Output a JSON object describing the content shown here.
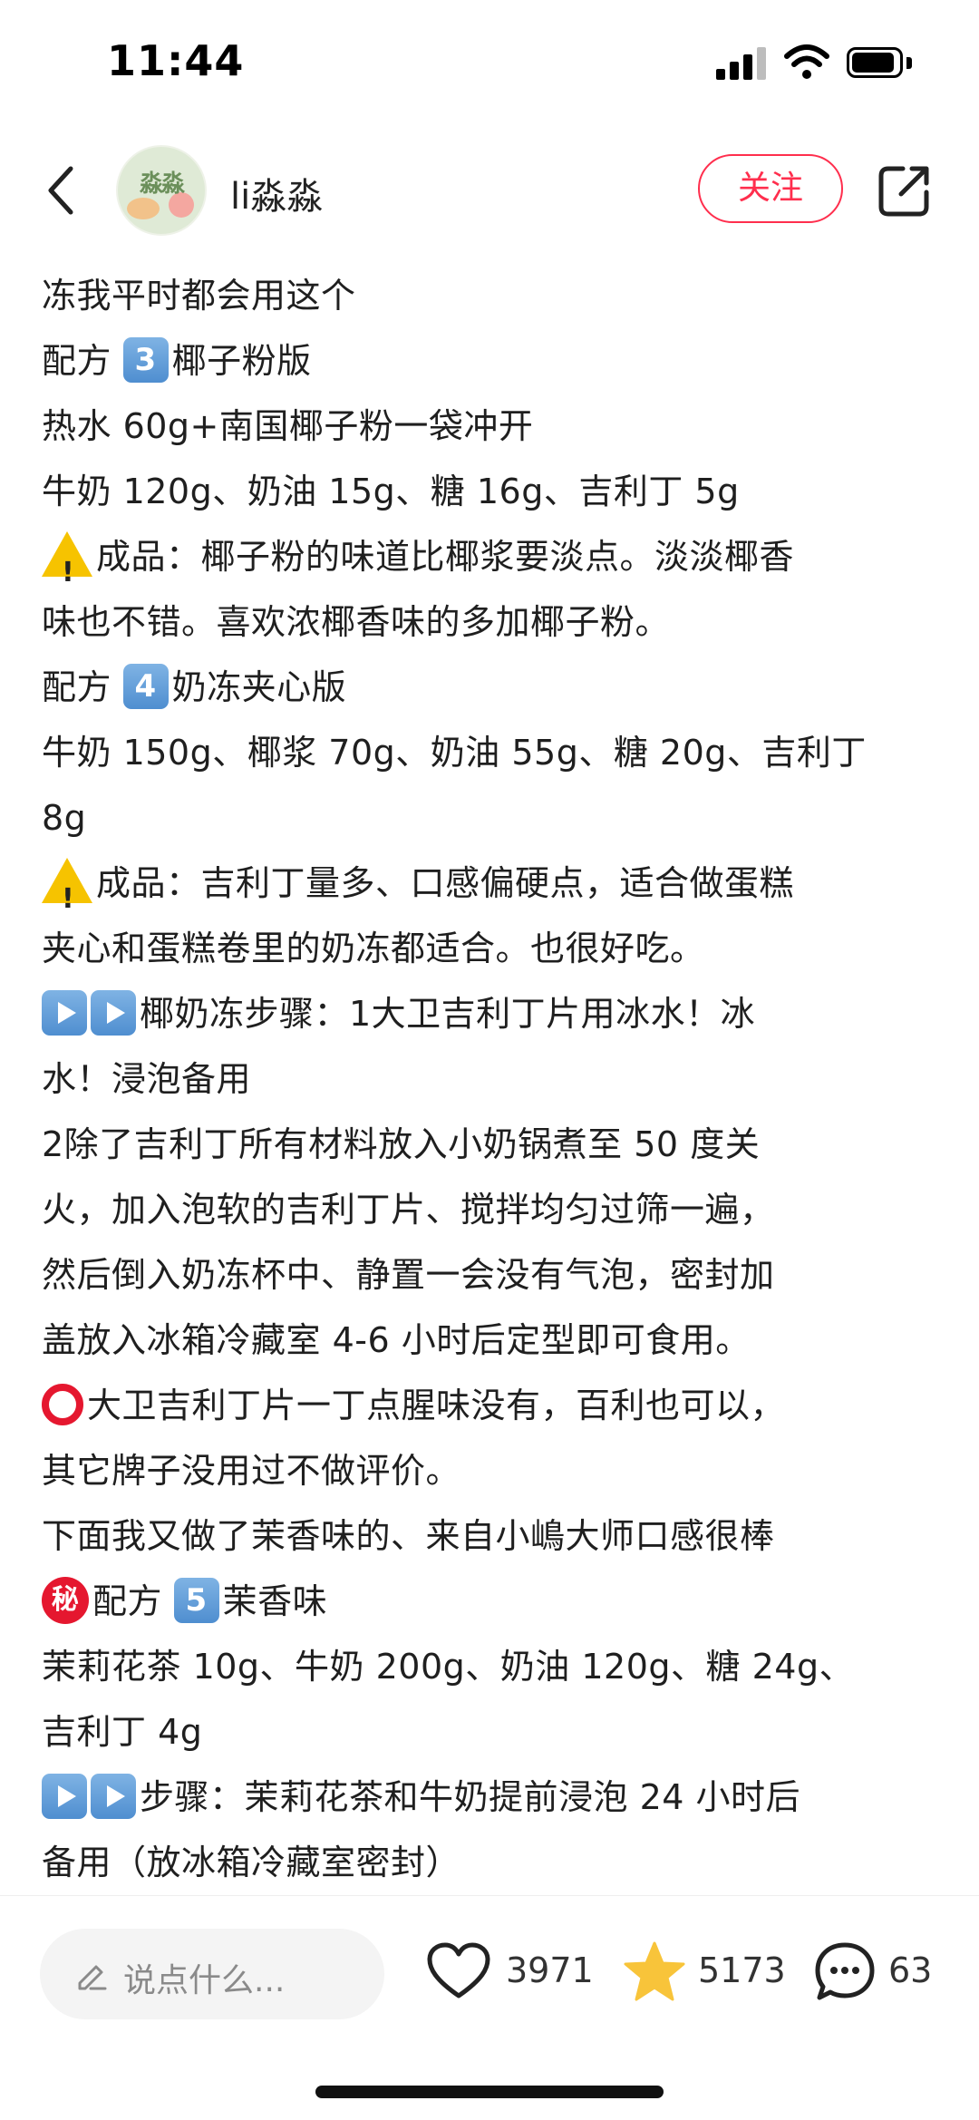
{
  "status_bar": {
    "time": "11:44"
  },
  "header": {
    "author_name": "li淼淼",
    "avatar_text": "淼淼",
    "follow_label": "关注"
  },
  "content": {
    "lines": [
      "冻我平时都会用这个",
      "配方 3 椰子粉版",
      "热水 60g+南国椰子粉一袋冲开",
      "牛奶 120g、奶油 15g、糖 16g、吉利丁 5g",
      "成品：椰子粉的味道比椰浆要淡点。淡淡椰香",
      "味也不错。喜欢浓椰香味的多加椰子粉。",
      "配方 4 奶冻夹心版",
      "牛奶 150g、椰浆 70g、奶油 55g、糖 20g、吉利丁",
      "8g",
      "成品：吉利丁量多、口感偏硬点，适合做蛋糕",
      "夹心和蛋糕卷里的奶冻都适合。也很好吃。",
      "椰奶冻步骤：1大卫吉利丁片用冰水！冰",
      "水！浸泡备用",
      "2除了吉利丁所有材料放入小奶锅煮至 50 度关",
      "火，加入泡软的吉利丁片、搅拌均匀过筛一遍，",
      "然后倒入奶冻杯中、静置一会没有气泡，密封加",
      "盖放入冰箱冷藏室 4-6 小时后定型即可食用。",
      "大卫吉利丁片一丁点腥味没有，百利也可以，",
      "其它牌子没用过不做评价。",
      "下面我又做了茉香味的、来自小嶋大师口感很棒",
      "配方 5 茉香味",
      "茉莉花茶 10g、牛奶 200g、奶油 120g、糖 24g、",
      "吉利丁 4g",
      "步骤：茉莉花茶和牛奶提前浸泡 24 小时后",
      "备用（放冰箱冷藏室密封）"
    ],
    "recipe3": {
      "prefix": "配方 ",
      "num": "3",
      "suffix": "椰子粉版"
    },
    "recipe4": {
      "prefix": "配方 ",
      "num": "4",
      "suffix": "奶冻夹心版"
    },
    "recipe5": {
      "prefix": "配方 ",
      "num": "5",
      "suffix": "茉香味",
      "secret": "秘"
    }
  },
  "bottom_bar": {
    "comment_placeholder": "说点什么...",
    "likes": "3971",
    "favorites": "5173",
    "comments": "63"
  },
  "icons": [
    "back-icon",
    "share-icon",
    "pencil-icon",
    "heart-icon",
    "star-icon",
    "comment-icon",
    "warning-icon",
    "play-icon",
    "red-circle-icon",
    "secret-icon"
  ],
  "colors": {
    "accent": "#ff2e4d",
    "star": "#f8c43a",
    "keycap": "#5b97d6"
  }
}
